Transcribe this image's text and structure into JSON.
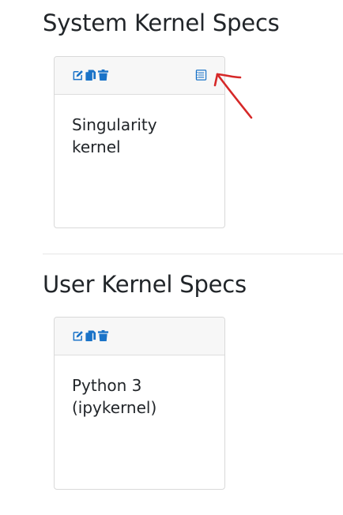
{
  "sections": [
    {
      "title": "System Kernel Specs",
      "cards": [
        {
          "name": "Singularity kernel"
        }
      ]
    },
    {
      "title": "User Kernel Specs",
      "cards": [
        {
          "name": "Python 3 (ipykernel)"
        }
      ]
    }
  ],
  "icons": {
    "edit": "edit-icon",
    "copy": "copy-icon",
    "delete": "trash-icon",
    "details": "notebook-icon"
  },
  "colors": {
    "accent": "#1a73c8",
    "annotation": "#d62828",
    "header_bg": "#f7f7f7",
    "border": "#d9d9d9"
  }
}
